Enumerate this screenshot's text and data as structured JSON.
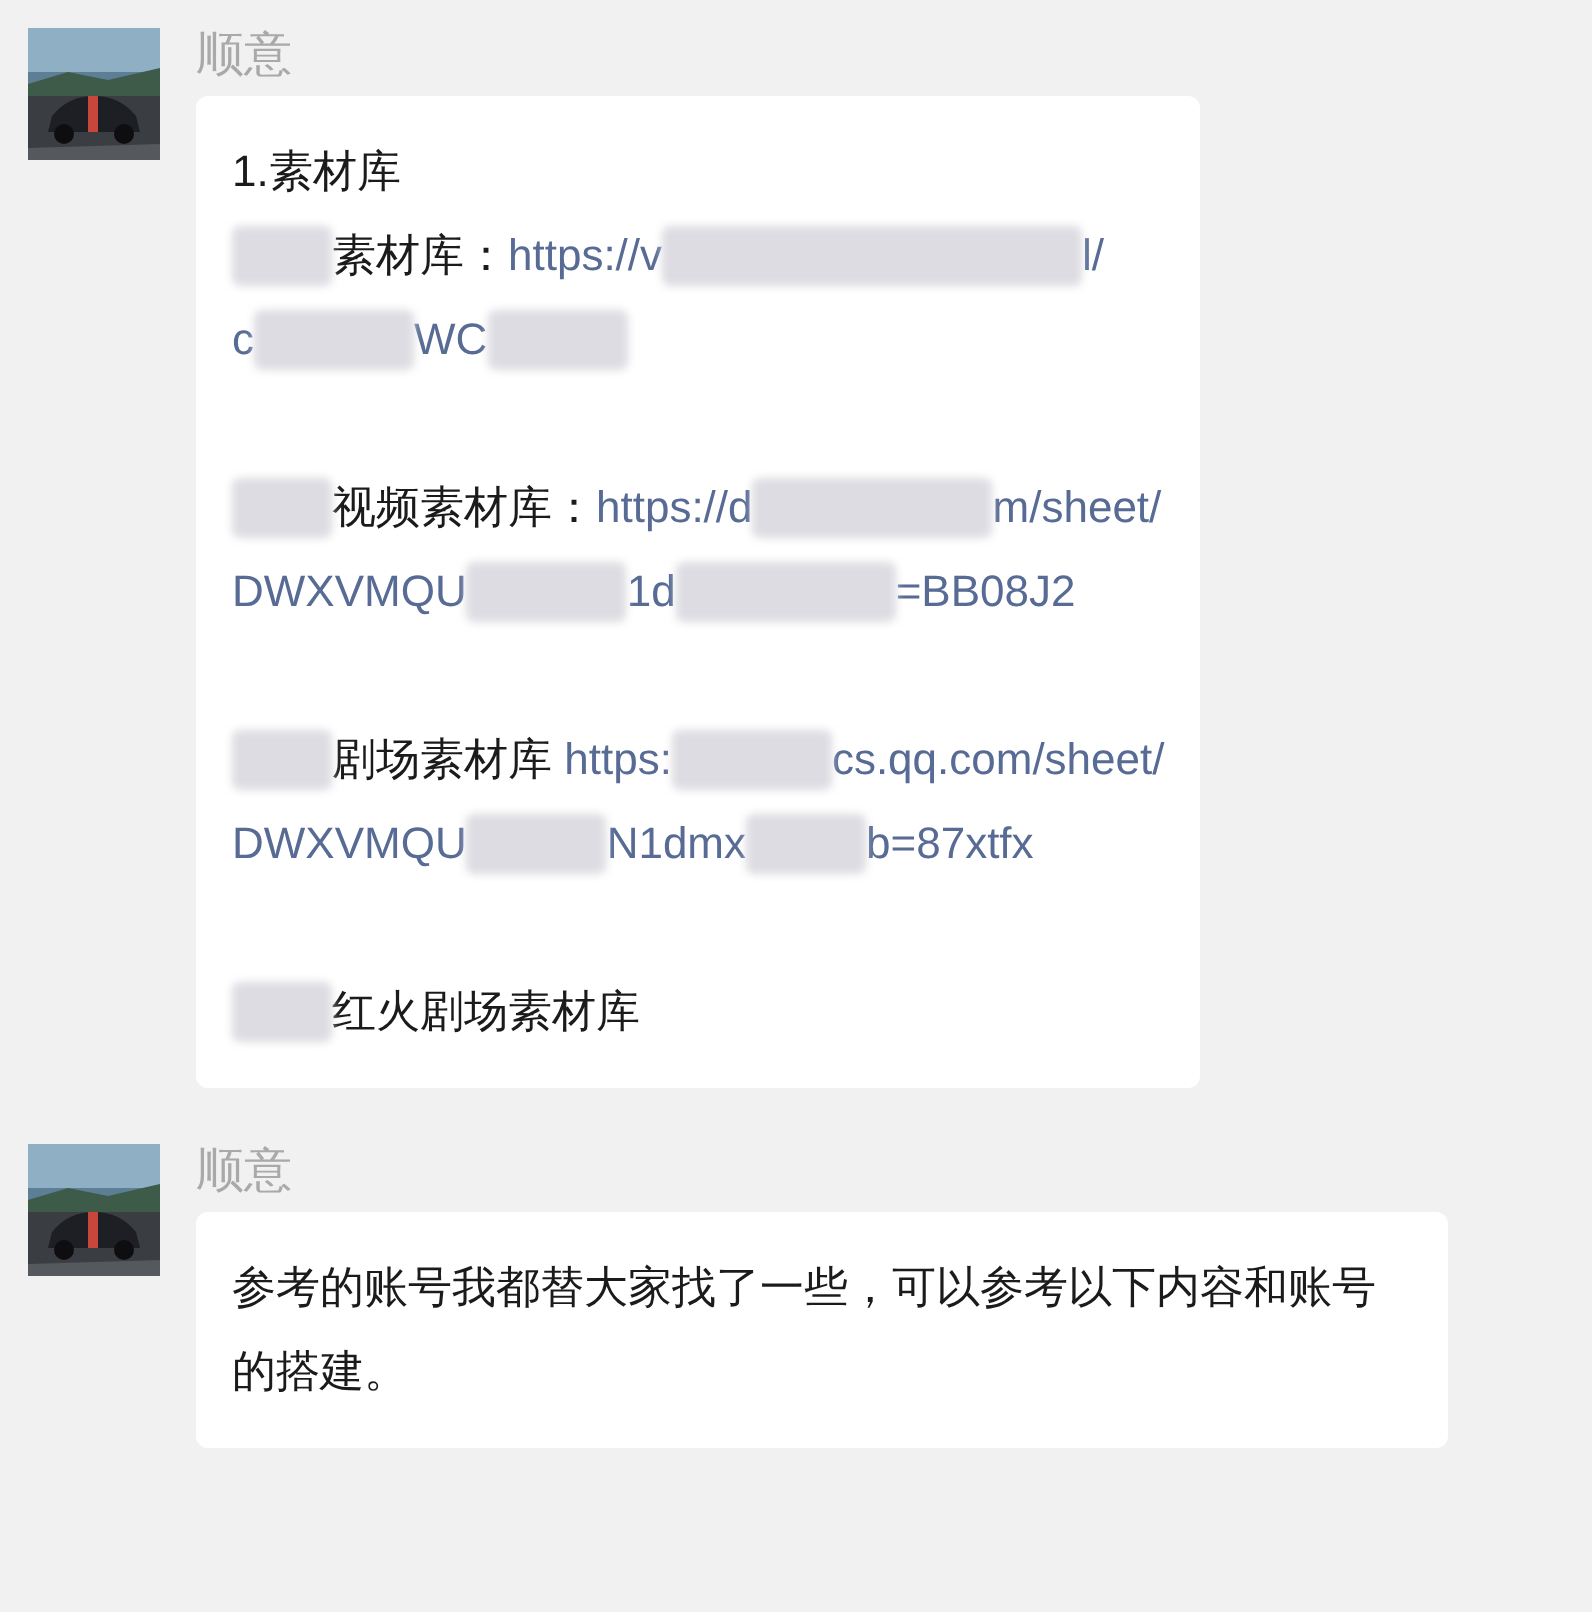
{
  "messages": [
    {
      "sender": "顺意",
      "avatar": {
        "kind": "picture"
      },
      "paragraphs": [
        [
          [
            {
              "kind": "text",
              "text": "1.素材库"
            }
          ],
          [
            {
              "kind": "redacted"
            },
            {
              "kind": "text",
              "text": "素材库："
            },
            {
              "kind": "link",
              "text": "https://v"
            },
            {
              "kind": "redacted"
            },
            {
              "kind": "link",
              "text": "l/"
            }
          ],
          [
            {
              "kind": "link",
              "text": "c"
            },
            {
              "kind": "redacted"
            },
            {
              "kind": "link",
              "text": "WC"
            },
            {
              "kind": "redacted"
            }
          ]
        ],
        [
          [
            {
              "kind": "redacted"
            },
            {
              "kind": "text",
              "text": "视频素材库："
            },
            {
              "kind": "link",
              "text": "https://d"
            },
            {
              "kind": "redacted"
            },
            {
              "kind": "link",
              "text": "m/sheet/"
            }
          ],
          [
            {
              "kind": "link",
              "text": "DWXVMQU"
            },
            {
              "kind": "redacted"
            },
            {
              "kind": "link",
              "text": "1d"
            },
            {
              "kind": "redacted"
            },
            {
              "kind": "link",
              "text": "=BB08J2"
            }
          ]
        ],
        [
          [
            {
              "kind": "redacted"
            },
            {
              "kind": "text",
              "text": "剧场素材库 "
            },
            {
              "kind": "link",
              "text": "https:"
            },
            {
              "kind": "redacted"
            },
            {
              "kind": "link",
              "text": "cs.qq.com/sheet/"
            }
          ],
          [
            {
              "kind": "link",
              "text": "DWXVMQU"
            },
            {
              "kind": "redacted"
            },
            {
              "kind": "link",
              "text": "N1dmx"
            },
            {
              "kind": "redacted"
            },
            {
              "kind": "link",
              "text": "b=87xtfx"
            }
          ]
        ],
        [
          [
            {
              "kind": "redacted"
            },
            {
              "kind": "text",
              "text": "红火剧场素材库"
            }
          ]
        ]
      ]
    },
    {
      "sender": "顺意",
      "avatar": {
        "kind": "picture"
      },
      "paragraphs": [
        [
          [
            {
              "kind": "text",
              "text": "参考的账号我都替大家找了一些，可以参考以下内容和账号的搭建。"
            }
          ]
        ]
      ]
    }
  ]
}
